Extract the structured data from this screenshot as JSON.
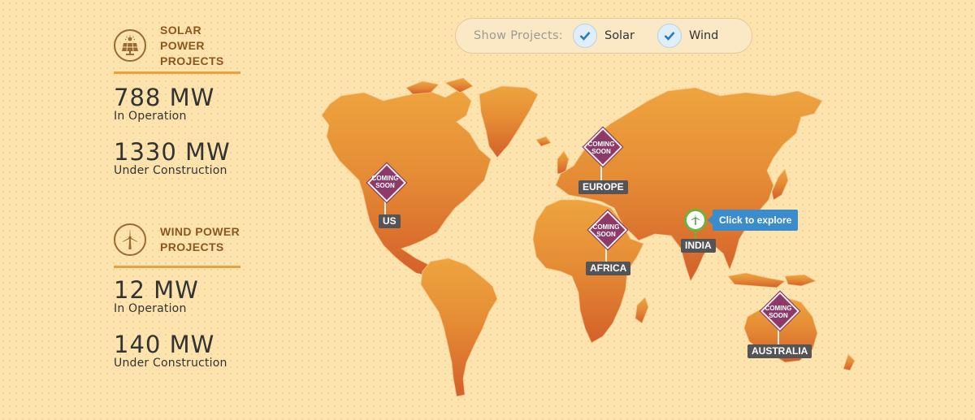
{
  "solar": {
    "title": "SOLAR POWER\nPROJECTS",
    "icon": "solar-panel-icon",
    "operation_value": "788 MW",
    "operation_label": "In Operation",
    "construction_value": "1330 MW",
    "construction_label": "Under Construction"
  },
  "wind": {
    "title": "WIND POWER\nPROJECTS",
    "icon": "wind-turbine-icon",
    "operation_value": "12 MW",
    "operation_label": "In Operation",
    "construction_value": "140 MW",
    "construction_label": "Under Construction"
  },
  "filter": {
    "label": "Show Projects:",
    "options": [
      {
        "label": "Solar",
        "checked": true
      },
      {
        "label": "Wind",
        "checked": true
      }
    ]
  },
  "map": {
    "regions": [
      {
        "name": "US",
        "status": "COMING\nSOON"
      },
      {
        "name": "EUROPE",
        "status": "COMING\nSOON"
      },
      {
        "name": "AFRICA",
        "status": "COMING\nSOON"
      },
      {
        "name": "AUSTRALIA",
        "status": "COMING\nSOON"
      },
      {
        "name": "INDIA",
        "status": ""
      }
    ],
    "explore_tooltip": "Click to explore"
  },
  "colors": {
    "background": "#fde3ad",
    "land_top": "#eea43e",
    "land_bottom": "#d4602a",
    "accent_rule": "#e9a03f",
    "heading": "#8c561f",
    "marker": "#8d3a69",
    "label_bg": "#545456",
    "tooltip": "#3b8ccd",
    "india_pin": "#6cb33f"
  }
}
